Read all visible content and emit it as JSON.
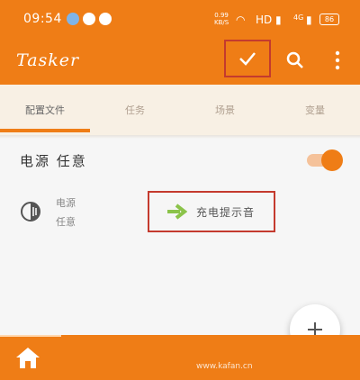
{
  "status_bar": {
    "time": "09:54",
    "speed_value": "0.99",
    "speed_unit": "KB/S",
    "network": "HD",
    "signal": "4G",
    "battery": "86"
  },
  "toolbar": {
    "title": "Tasker"
  },
  "tabs": [
    {
      "label": "配置文件",
      "active": true
    },
    {
      "label": "任务",
      "active": false
    },
    {
      "label": "场景",
      "active": false
    },
    {
      "label": "变量",
      "active": false
    }
  ],
  "profile": {
    "name": "电源 任意",
    "enabled": true,
    "context_line1": "电源",
    "context_line2": "任意",
    "task_label": "充电提示音"
  },
  "bottom_bar": {
    "watermark": "www.kafan.cn"
  },
  "colors": {
    "accent": "#ef7d16",
    "highlight_box": "#c43a2e",
    "task_arrow": "#8bc34a"
  }
}
